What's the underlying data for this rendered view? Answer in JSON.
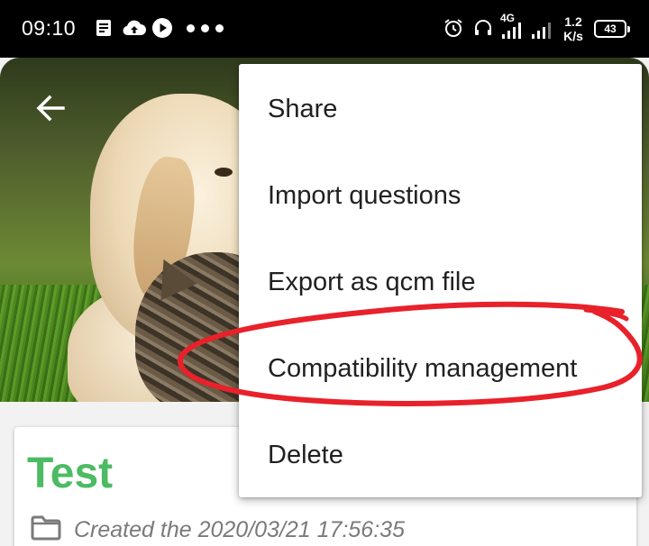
{
  "status_bar": {
    "time": "09:10",
    "network_type": "4G",
    "speed_value": "1.2",
    "speed_unit": "K/s",
    "battery": "43",
    "icons": [
      "news-icon",
      "cloud-upload-icon",
      "play-icon",
      "more-dots-icon",
      "alarm-icon",
      "headset-icon",
      "signal-icon",
      "signal-icon",
      "hotspot-icon",
      "battery-icon"
    ]
  },
  "header": {
    "back_icon": "arrow-left-icon"
  },
  "menu": {
    "items": [
      {
        "label": "Share"
      },
      {
        "label": "Import questions"
      },
      {
        "label": "Export as qcm file"
      },
      {
        "label": "Compatibility management"
      },
      {
        "label": "Delete"
      }
    ]
  },
  "card": {
    "title": "Test",
    "folder_icon": "folder-icon",
    "created_text": "Created the 2020/03/21 17:56:35"
  },
  "colors": {
    "title_green": "#4cbb63",
    "annotation_red": "#e8212a",
    "status_bar_bg": "#000000"
  }
}
